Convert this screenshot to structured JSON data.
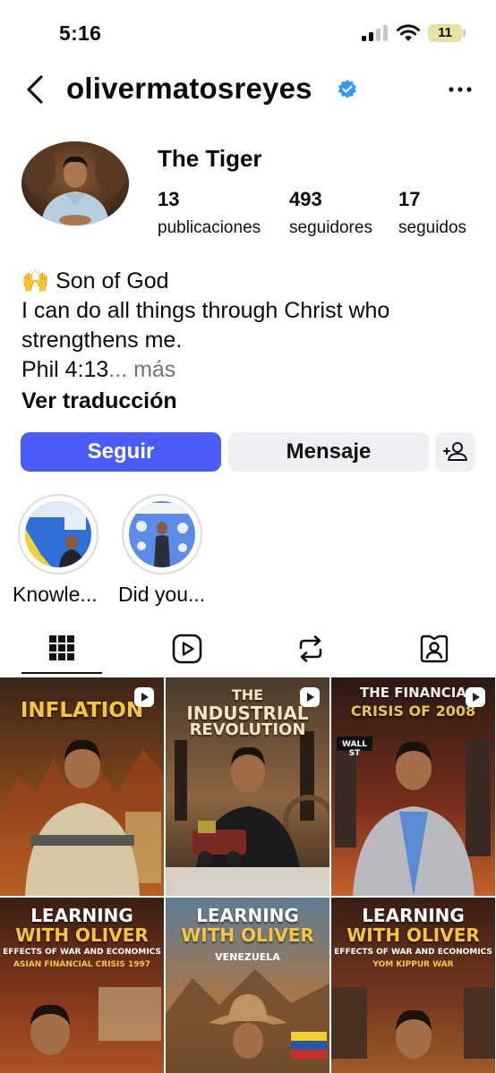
{
  "status_bar": {
    "time": "5:16",
    "battery": "11"
  },
  "header": {
    "username": "olivermatosreyes"
  },
  "profile": {
    "name": "The Tiger",
    "stats": [
      {
        "value": "13",
        "label": "publicaciones"
      },
      {
        "value": "493",
        "label": "seguidores"
      },
      {
        "value": "17",
        "label": "seguidos"
      }
    ],
    "bio": {
      "line1": "🙌 Son of God",
      "line2": "I can do all things through Christ who",
      "line3": "strengthens me.",
      "line4": "Phil 4:13",
      "more": "... más"
    },
    "translate": "Ver traducción"
  },
  "buttons": {
    "follow": "Seguir",
    "message": "Mensaje"
  },
  "highlights": [
    {
      "label": "Knowle..."
    },
    {
      "label": "Did you..."
    }
  ],
  "tabs": [
    {
      "icon": "grid-icon",
      "selected": true
    },
    {
      "icon": "reels-icon",
      "selected": false
    },
    {
      "icon": "reposts-icon",
      "selected": false
    },
    {
      "icon": "tagged-icon",
      "selected": false
    }
  ],
  "posts": [
    {
      "title_line1": "INFLATION",
      "title_line2": ""
    },
    {
      "title_line1": "THE",
      "title_line2": "INDUSTRIAL",
      "title_line3": "REVOLUTION"
    },
    {
      "title_line1": "THE FINANCIA",
      "title_line2": "CRISIS OF 2008",
      "sign": "WALL ST"
    },
    {
      "title_line1": "LEARNING",
      "title_line2": "WITH OLIVER",
      "sub1": "EFFECTS OF WAR AND ECONOMICS",
      "sub2": "ASIAN FINANCIAL CRISIS 1997"
    },
    {
      "title_line1": "LEARNING",
      "title_line2": "WITH OLIVER",
      "sub1": "VENEZUELA"
    },
    {
      "title_line1": "LEARNING",
      "title_line2": "WITH OLIVER",
      "sub1": "EFFECTS OF WAR AND ECONOMICS",
      "sub2": "YOM KIPPUR WAR"
    }
  ],
  "colors": {
    "accent": "#4a5df9",
    "verified": "#3897f0",
    "gold": "#f4c542"
  }
}
